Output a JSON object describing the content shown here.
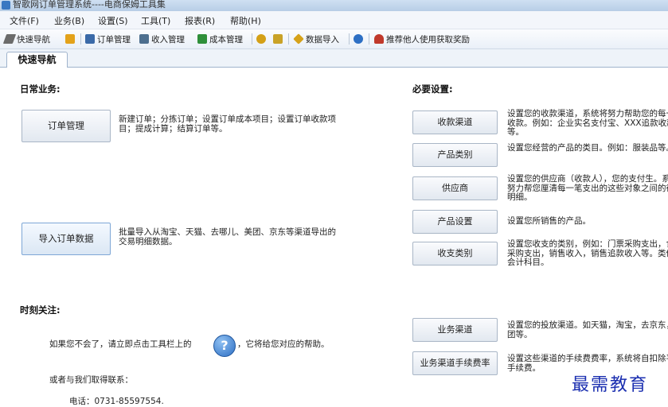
{
  "window": {
    "title": "智歌网订单管理系统----电商保姆工具集"
  },
  "menu": [
    "文件(F)",
    "业务(B)",
    "设置(S)",
    "工具(T)",
    "报表(R)",
    "帮助(H)"
  ],
  "toolbar": {
    "items": [
      {
        "label": "快速导航",
        "icon": "pen-icon",
        "color": "#6b6b6b"
      },
      {
        "label": "",
        "icon": "note-icon",
        "color": "#e3a21a"
      },
      {
        "label": "订单管理",
        "icon": "grid-icon",
        "color": "#3b6aa8"
      },
      {
        "label": "收入管理",
        "icon": "register-icon",
        "color": "#4d6f8f"
      },
      {
        "label": "成本管理",
        "icon": "chart-icon",
        "color": "#2f8f3a"
      },
      {
        "label": "",
        "icon": "coins-icon",
        "color": "#d4a017"
      },
      {
        "label": "",
        "icon": "money-icon",
        "color": "#c9a227"
      },
      {
        "label": "数据导入",
        "icon": "import-icon",
        "color": "#d6a21a"
      },
      {
        "label": "",
        "icon": "help-icon",
        "color": "#2d6fc4"
      },
      {
        "label": "推荐他人使用获取奖励",
        "icon": "people-icon",
        "color": "#c0392b"
      }
    ]
  },
  "tab": {
    "label": "快速导航"
  },
  "daily": {
    "title": "日常业务:",
    "order_btn": "订单管理",
    "order_desc": "新建订单；分拣订单；设置订单成本项目；设置订单收款项目；提成计算；结算订单等。",
    "import_btn": "导入订单数据",
    "import_desc": "批量导入从淘宝、天猫、去哪儿、美团、京东等渠道导出的交易明细数据。"
  },
  "settings": {
    "title": "必要设置:",
    "rows": [
      {
        "button": "收款渠道",
        "desc": "设置您的收款渠道，系统将努力帮助您的每一笔收款。例如：企业实名支付宝、XXX追款收款等。"
      },
      {
        "button": "产品类别",
        "desc": "设置您经营的产品的类目。例如：服装品等。"
      },
      {
        "button": "供应商",
        "desc": "设置您的供应商（收款人），您的支付生。系统将努力帮您厘清每一笔支出的这些对象之间的往来明细。"
      },
      {
        "button": "产品设置",
        "desc": "设置您所销售的产品。"
      },
      {
        "button": "收支类别",
        "desc": "设置您收支的类别，例如：门票采购支出，食品采购支出，销售收入，销售追款收入等。类似于会计科目。"
      },
      {
        "button": "业务渠道",
        "desc": "设置您的投放渠道。如天猫，淘宝，去京东，美团等。"
      },
      {
        "button": "业务渠道手续费率",
        "desc": "设置这些渠道的手续费费率，系统将自扣除平台手续费。"
      }
    ]
  },
  "attention": {
    "title": "时刻关注:",
    "help_before": "如果您不会了，请立即点击工具栏上的",
    "help_icon_glyph": "?",
    "help_after": "，它将给您对应的帮助。",
    "contact": "或者与我们取得联系：",
    "phone": "电话：0731-85597554."
  },
  "watermark": "最需教育"
}
